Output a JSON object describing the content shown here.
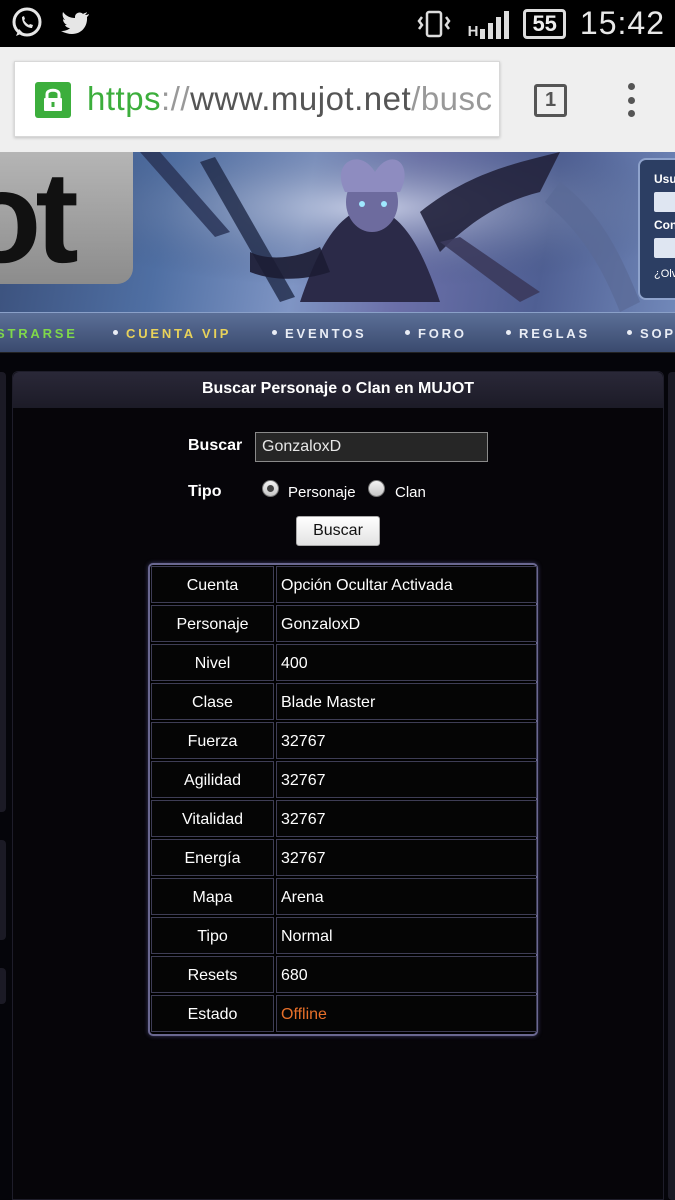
{
  "status_bar": {
    "time": "15:42",
    "battery": "55",
    "network": "H",
    "icons": [
      "whatsapp-icon",
      "twitter-icon",
      "vibrate-icon",
      "signal-icon"
    ]
  },
  "browser": {
    "url_scheme": "https",
    "url_sep": "://",
    "url_host": "www.mujot.net",
    "url_rest": "/busc",
    "tab_count": "1"
  },
  "banner": {
    "logo": "ot",
    "login_user_label": "Usu",
    "login_pass_label": "Con",
    "login_forgot_label": "¿Olv"
  },
  "nav": {
    "items": [
      {
        "label": "STRARSE",
        "color": "#7fd84a"
      },
      {
        "label": "CUENTA VIP",
        "color": "#e8d25a"
      },
      {
        "label": "EVENTOS",
        "color": "#e9edf5"
      },
      {
        "label": "FORO",
        "color": "#e9edf5"
      },
      {
        "label": "REGLAS",
        "color": "#e9edf5"
      },
      {
        "label": "SOP",
        "color": "#e9edf5"
      }
    ]
  },
  "panel": {
    "title": "Buscar Personaje o Clan en MUJOT"
  },
  "search_form": {
    "search_label": "Buscar",
    "search_value": "GonzaloxD",
    "type_label": "Tipo",
    "option_character": "Personaje",
    "option_clan": "Clan",
    "selected": "Personaje",
    "button_label": "Buscar"
  },
  "results": {
    "rows": [
      {
        "key": "Cuenta",
        "value": "Opción Ocultar Activada"
      },
      {
        "key": "Personaje",
        "value": "GonzaloxD"
      },
      {
        "key": "Nivel",
        "value": "400"
      },
      {
        "key": "Clase",
        "value": "Blade Master"
      },
      {
        "key": "Fuerza",
        "value": "32767"
      },
      {
        "key": "Agilidad",
        "value": "32767"
      },
      {
        "key": "Vitalidad",
        "value": "32767"
      },
      {
        "key": "Energía",
        "value": "32767"
      },
      {
        "key": "Mapa",
        "value": "Arena"
      },
      {
        "key": "Tipo",
        "value": "Normal"
      },
      {
        "key": "Resets",
        "value": "680"
      },
      {
        "key": "Estado",
        "value": "Offline"
      }
    ],
    "status_color": "#e8702a"
  }
}
